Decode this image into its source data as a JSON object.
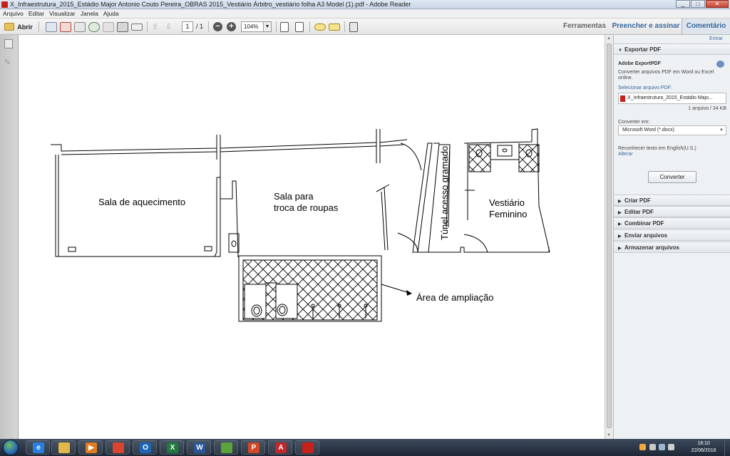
{
  "window": {
    "title": "X_Infraestrutura_2015_Estádio Major Antonio Couto Pereira_OBRAS 2015_Vestiário Árbitro_vestiário folha A3 Model (1).pdf - Adobe Reader",
    "min": "_",
    "max": "□",
    "close": "✕"
  },
  "menu": [
    "Arquivo",
    "Editar",
    "Visualizar",
    "Janela",
    "Ajuda"
  ],
  "toolbar": {
    "open_label": "Abrir",
    "page_current": "1",
    "page_total": "/ 1",
    "zoom": "104%",
    "tabs": [
      "Ferramentas",
      "Preencher e assinar",
      "Comentário"
    ]
  },
  "document": {
    "labels": {
      "sala_aquecimento": "Sala de aquecimento",
      "sala_para": "Sala para",
      "troca_roupas": "troca de roupas",
      "vestiario": "Vestiário",
      "feminino": "Feminino",
      "tunel": "Túnel acesso gramado",
      "ampliacao": "Área de ampliação"
    }
  },
  "panel": {
    "entrar": "Entrar",
    "export_header": "Exportar PDF",
    "export_title": "Adobe ExportPDF",
    "export_desc1": "Converter arquivos PDF em Word ou Excel",
    "export_desc2": "online.",
    "select_label": "Selecionar arquivo PDF:",
    "file_name": "X_Infraestrutura_2015_Estádio Majo...",
    "file_count": "1 arquivo / 34 KB",
    "convert_to_label": "Converter em:",
    "convert_to_value": "Microsoft Word (*.docx)",
    "ocr_text": "Reconhecer texto em English(U.S.)",
    "ocr_change": "Alterar",
    "convert_button": "Converter",
    "sections": [
      "Criar PDF",
      "Editar PDF",
      "Combinar PDF",
      "Enviar arquivos",
      "Armazenar arquivos"
    ]
  },
  "taskbar": {
    "time": "18:10",
    "date": "22/06/2016",
    "apps": [
      {
        "name": "internet-explorer",
        "glyph": "e",
        "color": "#2a7de1"
      },
      {
        "name": "file-explorer",
        "glyph": "",
        "color": "#e2b84a"
      },
      {
        "name": "media-player",
        "glyph": "▶",
        "color": "#e07b1f"
      },
      {
        "name": "chrome",
        "glyph": "",
        "color": "#d9432f"
      },
      {
        "name": "outlook",
        "glyph": "O",
        "color": "#1e66b5"
      },
      {
        "name": "excel",
        "glyph": "X",
        "color": "#1f7a3c"
      },
      {
        "name": "word",
        "glyph": "W",
        "color": "#2b579a"
      },
      {
        "name": "app-green",
        "glyph": "",
        "color": "#5aa43a"
      },
      {
        "name": "powerpoint",
        "glyph": "P",
        "color": "#d24726"
      },
      {
        "name": "autocad",
        "glyph": "A",
        "color": "#c0282d"
      },
      {
        "name": "adobe-reader",
        "glyph": "",
        "color": "#c8201a"
      }
    ]
  }
}
